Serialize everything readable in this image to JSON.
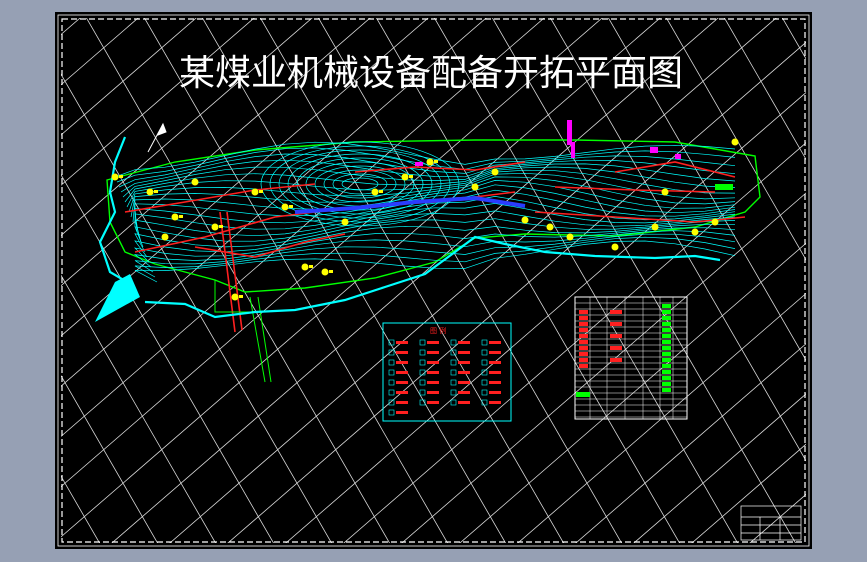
{
  "drawing": {
    "title": "某煤业机械设备配备开拓平面图"
  },
  "colors": {
    "frame_background": "#96a0b4",
    "sheet_background": "#000000",
    "grid": "#ffffff",
    "contours": "#00ffff",
    "boundary": "#00ff00",
    "roadways": "#ff2020",
    "main_roadway": "#2a3cff",
    "equipment": "#ffff00",
    "river": "#00ffff",
    "annotations": "#ff00ff",
    "legend_border": "#00ffff"
  },
  "icons": {
    "north_arrow": "north-arrow-icon"
  }
}
